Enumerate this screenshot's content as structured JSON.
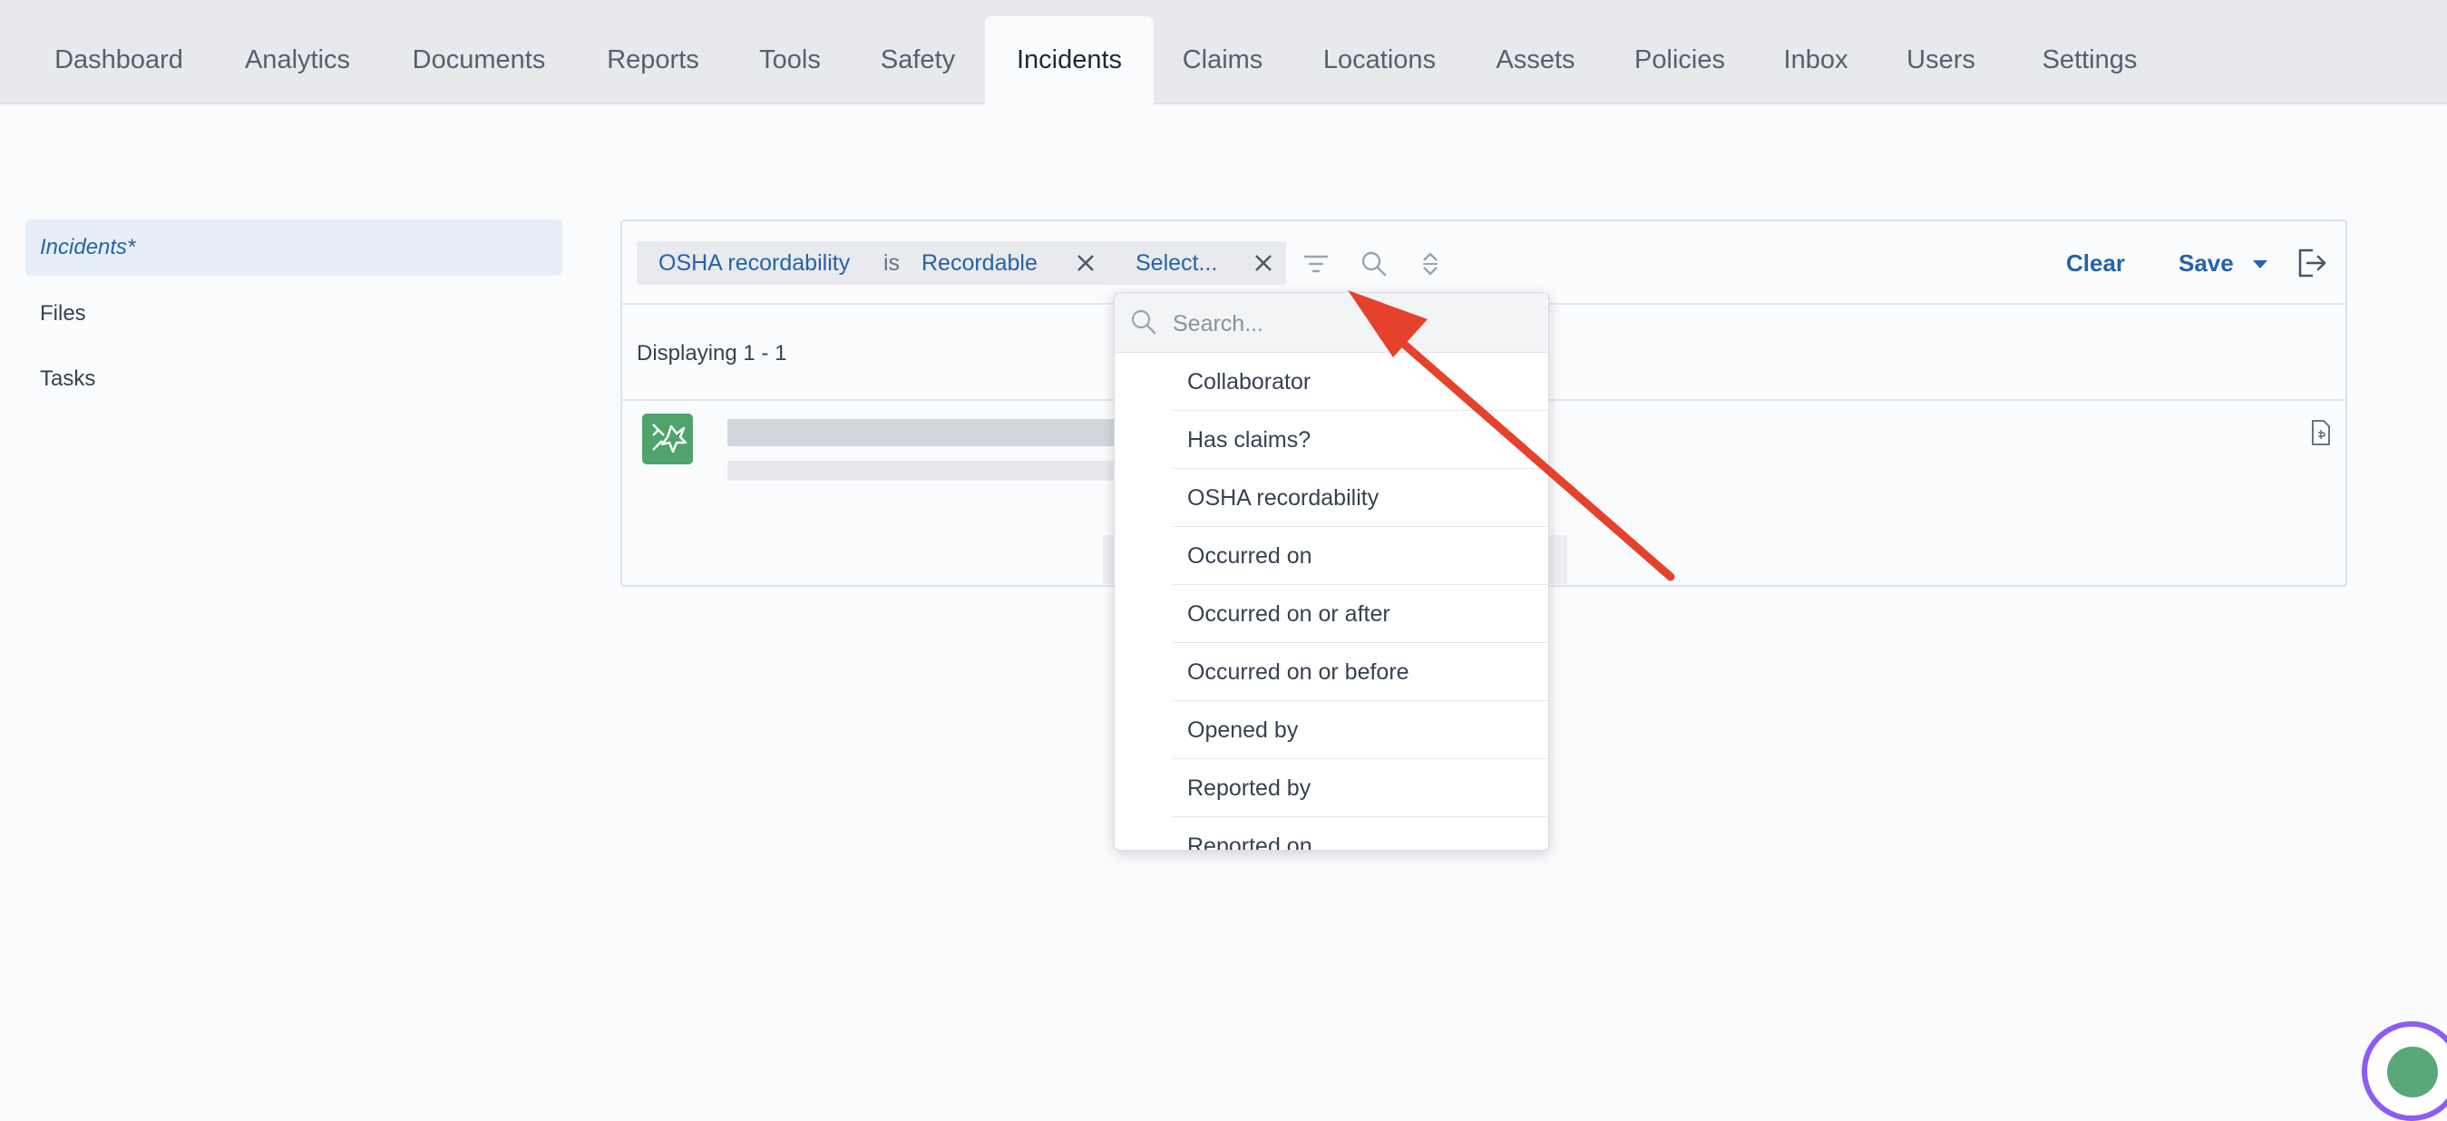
{
  "topnav": {
    "tabs": [
      {
        "label": "Dashboard"
      },
      {
        "label": "Analytics"
      },
      {
        "label": "Documents"
      },
      {
        "label": "Reports"
      },
      {
        "label": "Tools"
      },
      {
        "label": "Safety"
      },
      {
        "label": "Incidents",
        "active": true
      },
      {
        "label": "Claims"
      },
      {
        "label": "Locations"
      },
      {
        "label": "Assets"
      },
      {
        "label": "Policies"
      },
      {
        "label": "Inbox"
      },
      {
        "label": "Users"
      },
      {
        "label": "Settings"
      }
    ]
  },
  "sidebar": {
    "items": [
      {
        "label": "Incidents*",
        "active": true
      },
      {
        "label": "Files"
      },
      {
        "label": "Tasks"
      }
    ]
  },
  "filter": {
    "field": "OSHA recordability",
    "operator": "is",
    "value": "Recordable",
    "select_placeholder": "Select...",
    "clear_label": "Clear",
    "save_label": "Save"
  },
  "results": {
    "displaying": "Displaying 1 - 1"
  },
  "dropdown": {
    "search_placeholder": "Search...",
    "options": [
      "Collaborator",
      "Has claims?",
      "OSHA recordability",
      "Occurred on",
      "Occurred on or after",
      "Occurred on or before",
      "Opened by",
      "Reported by",
      "Reported on"
    ]
  },
  "colors": {
    "accent": "#2563a8",
    "annotation_arrow": "#e5412d",
    "incident_icon": "#4fa36b"
  }
}
